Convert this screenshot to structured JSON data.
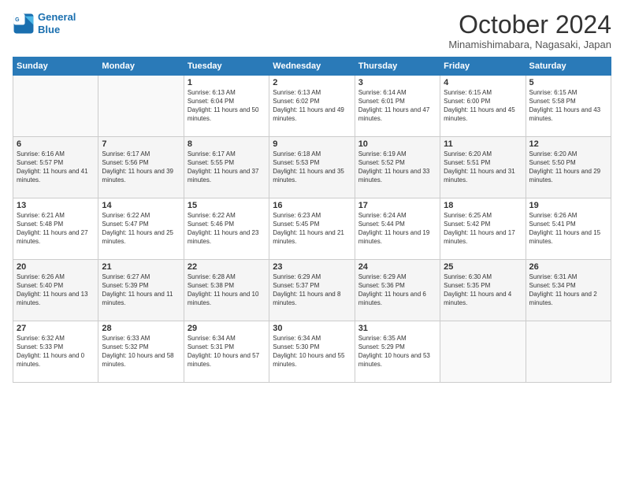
{
  "logo": {
    "line1": "General",
    "line2": "Blue"
  },
  "title": "October 2024",
  "location": "Minamishimabara, Nagasaki, Japan",
  "headers": [
    "Sunday",
    "Monday",
    "Tuesday",
    "Wednesday",
    "Thursday",
    "Friday",
    "Saturday"
  ],
  "weeks": [
    [
      {
        "day": "",
        "content": ""
      },
      {
        "day": "",
        "content": ""
      },
      {
        "day": "1",
        "content": "Sunrise: 6:13 AM\nSunset: 6:04 PM\nDaylight: 11 hours and 50 minutes."
      },
      {
        "day": "2",
        "content": "Sunrise: 6:13 AM\nSunset: 6:02 PM\nDaylight: 11 hours and 49 minutes."
      },
      {
        "day": "3",
        "content": "Sunrise: 6:14 AM\nSunset: 6:01 PM\nDaylight: 11 hours and 47 minutes."
      },
      {
        "day": "4",
        "content": "Sunrise: 6:15 AM\nSunset: 6:00 PM\nDaylight: 11 hours and 45 minutes."
      },
      {
        "day": "5",
        "content": "Sunrise: 6:15 AM\nSunset: 5:58 PM\nDaylight: 11 hours and 43 minutes."
      }
    ],
    [
      {
        "day": "6",
        "content": "Sunrise: 6:16 AM\nSunset: 5:57 PM\nDaylight: 11 hours and 41 minutes."
      },
      {
        "day": "7",
        "content": "Sunrise: 6:17 AM\nSunset: 5:56 PM\nDaylight: 11 hours and 39 minutes."
      },
      {
        "day": "8",
        "content": "Sunrise: 6:17 AM\nSunset: 5:55 PM\nDaylight: 11 hours and 37 minutes."
      },
      {
        "day": "9",
        "content": "Sunrise: 6:18 AM\nSunset: 5:53 PM\nDaylight: 11 hours and 35 minutes."
      },
      {
        "day": "10",
        "content": "Sunrise: 6:19 AM\nSunset: 5:52 PM\nDaylight: 11 hours and 33 minutes."
      },
      {
        "day": "11",
        "content": "Sunrise: 6:20 AM\nSunset: 5:51 PM\nDaylight: 11 hours and 31 minutes."
      },
      {
        "day": "12",
        "content": "Sunrise: 6:20 AM\nSunset: 5:50 PM\nDaylight: 11 hours and 29 minutes."
      }
    ],
    [
      {
        "day": "13",
        "content": "Sunrise: 6:21 AM\nSunset: 5:48 PM\nDaylight: 11 hours and 27 minutes."
      },
      {
        "day": "14",
        "content": "Sunrise: 6:22 AM\nSunset: 5:47 PM\nDaylight: 11 hours and 25 minutes."
      },
      {
        "day": "15",
        "content": "Sunrise: 6:22 AM\nSunset: 5:46 PM\nDaylight: 11 hours and 23 minutes."
      },
      {
        "day": "16",
        "content": "Sunrise: 6:23 AM\nSunset: 5:45 PM\nDaylight: 11 hours and 21 minutes."
      },
      {
        "day": "17",
        "content": "Sunrise: 6:24 AM\nSunset: 5:44 PM\nDaylight: 11 hours and 19 minutes."
      },
      {
        "day": "18",
        "content": "Sunrise: 6:25 AM\nSunset: 5:42 PM\nDaylight: 11 hours and 17 minutes."
      },
      {
        "day": "19",
        "content": "Sunrise: 6:26 AM\nSunset: 5:41 PM\nDaylight: 11 hours and 15 minutes."
      }
    ],
    [
      {
        "day": "20",
        "content": "Sunrise: 6:26 AM\nSunset: 5:40 PM\nDaylight: 11 hours and 13 minutes."
      },
      {
        "day": "21",
        "content": "Sunrise: 6:27 AM\nSunset: 5:39 PM\nDaylight: 11 hours and 11 minutes."
      },
      {
        "day": "22",
        "content": "Sunrise: 6:28 AM\nSunset: 5:38 PM\nDaylight: 11 hours and 10 minutes."
      },
      {
        "day": "23",
        "content": "Sunrise: 6:29 AM\nSunset: 5:37 PM\nDaylight: 11 hours and 8 minutes."
      },
      {
        "day": "24",
        "content": "Sunrise: 6:29 AM\nSunset: 5:36 PM\nDaylight: 11 hours and 6 minutes."
      },
      {
        "day": "25",
        "content": "Sunrise: 6:30 AM\nSunset: 5:35 PM\nDaylight: 11 hours and 4 minutes."
      },
      {
        "day": "26",
        "content": "Sunrise: 6:31 AM\nSunset: 5:34 PM\nDaylight: 11 hours and 2 minutes."
      }
    ],
    [
      {
        "day": "27",
        "content": "Sunrise: 6:32 AM\nSunset: 5:33 PM\nDaylight: 11 hours and 0 minutes."
      },
      {
        "day": "28",
        "content": "Sunrise: 6:33 AM\nSunset: 5:32 PM\nDaylight: 10 hours and 58 minutes."
      },
      {
        "day": "29",
        "content": "Sunrise: 6:34 AM\nSunset: 5:31 PM\nDaylight: 10 hours and 57 minutes."
      },
      {
        "day": "30",
        "content": "Sunrise: 6:34 AM\nSunset: 5:30 PM\nDaylight: 10 hours and 55 minutes."
      },
      {
        "day": "31",
        "content": "Sunrise: 6:35 AM\nSunset: 5:29 PM\nDaylight: 10 hours and 53 minutes."
      },
      {
        "day": "",
        "content": ""
      },
      {
        "day": "",
        "content": ""
      }
    ]
  ]
}
